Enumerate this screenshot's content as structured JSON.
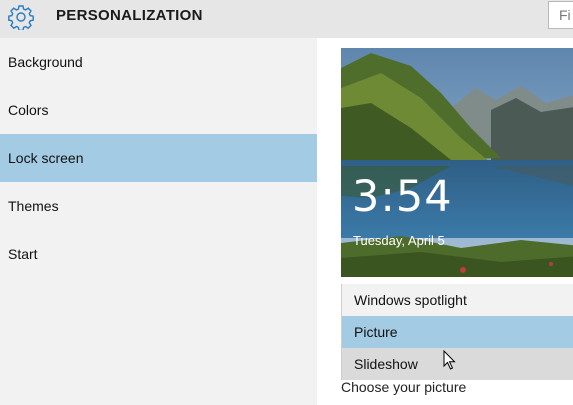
{
  "titlebar": {
    "title": "PERSONALIZATION",
    "icon": "gear-icon",
    "search_placeholder": "Fi"
  },
  "sidebar": {
    "items": [
      {
        "label": "Background"
      },
      {
        "label": "Colors"
      },
      {
        "label": "Lock screen",
        "selected": true
      },
      {
        "label": "Themes"
      },
      {
        "label": "Start"
      }
    ]
  },
  "preview": {
    "time": "3:54",
    "date": "Tuesday, April 5"
  },
  "dropdown": {
    "options": [
      {
        "label": "Windows spotlight"
      },
      {
        "label": "Picture",
        "selected": true
      },
      {
        "label": "Slideshow"
      }
    ]
  },
  "section": {
    "choose_picture_label": "Choose your picture"
  },
  "colors": {
    "accent": "#a3cbe4",
    "sidebar_bg": "#f2f2f2",
    "titlebar_bg": "#e6e6e6",
    "gear": "#2a7bc0"
  }
}
